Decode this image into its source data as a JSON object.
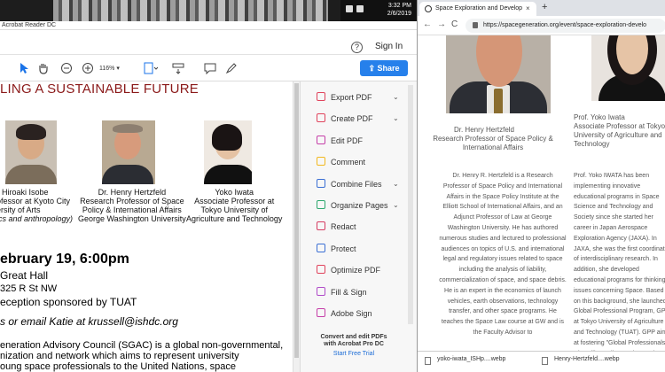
{
  "taskbar": {
    "time": "3:32 PM",
    "date": "2/6/2019"
  },
  "acrobat": {
    "title": "Acrobat Reader DC",
    "help_icon": "?",
    "sign_in": "Sign In",
    "zoom": "116%",
    "share": "Share"
  },
  "pdf": {
    "title": "LING A SUSTAINABLE FUTURE",
    "speakers": [
      {
        "name": "Hiroaki Isobe",
        "line2": "ofessor at Kyoto City",
        "line3": "ersity of Arts",
        "line4": "ics and anthropology)"
      },
      {
        "name": "Dr. Henry Hertzfeld",
        "line2": "Research Professor of Space",
        "line3": "Policy & International Affairs",
        "line4": "George Washington University"
      },
      {
        "name": "Yoko Iwata",
        "line2": "Associate Professor at",
        "line3": "Tokyo University of",
        "line4": "Agriculture and Technology"
      }
    ],
    "date": "ebruary 19, 6:00pm",
    "venue1": "Great Hall",
    "venue2": "325 R St NW",
    "reception": "eception sponsored by TUAT",
    "rsvp": "s or email Katie at krussell@ishdc.org",
    "para1": "eneration Advisory Council (SGAC) is a global non-governmental,",
    "para2": "nization and network which aims to represent university",
    "para3": "oung space professionals to the United Nations, space"
  },
  "tools": {
    "items": [
      {
        "label": "Export PDF",
        "chevron": "⌄",
        "color": "#e0435c"
      },
      {
        "label": "Create PDF",
        "chevron": "⌄",
        "color": "#e0435c"
      },
      {
        "label": "Edit PDF",
        "chevron": "",
        "color": "#c53ea8"
      },
      {
        "label": "Comment",
        "chevron": "",
        "color": "#f2b81f"
      },
      {
        "label": "Combine Files",
        "chevron": "⌄",
        "color": "#3b6fd4"
      },
      {
        "label": "Organize Pages",
        "chevron": "⌄",
        "color": "#2fa86f"
      },
      {
        "label": "Redact",
        "chevron": "",
        "color": "#d63c62"
      },
      {
        "label": "Protect",
        "chevron": "",
        "color": "#3b6fd4"
      },
      {
        "label": "Optimize PDF",
        "chevron": "",
        "color": "#e0435c"
      },
      {
        "label": "Fill & Sign",
        "chevron": "",
        "color": "#b04cc9"
      },
      {
        "label": "Adobe Sign",
        "chevron": "",
        "color": "#c53ea8"
      }
    ],
    "promo_line1": "Convert and edit PDFs",
    "promo_line2": "with Acrobat Pro DC",
    "trial": "Start Free Trial"
  },
  "browser": {
    "tab_title": "Space Exploration and Develop",
    "tab_close": "×",
    "new_tab": "+",
    "back": "←",
    "forward": "→",
    "reload": "C",
    "url": "https://spacegeneration.org/event/space-exploration-develo"
  },
  "web": {
    "hh_name": "Dr. Henry Hertzfeld",
    "hh_title": "Research Professor of Space Policy & International Affairs",
    "yi_name": "Prof. Yoko Iwata",
    "yi_title": "Associate Professor at Tokyo University of Agriculture and Technology",
    "hh_bio": "Dr. Henry R. Hertzfeld is a Research Professor of Space Policy and International Affairs in the Space Policy Institute at the Elliott School of International Affairs, and an Adjunct Professor of Law at George Washington University. He has authored numerous studies and lectured to professional audiences on topics of U.S. and international legal and regulatory issues related to space including the analysis of liability, commercialization of space, and space debris. He is an expert in the economics of launch vehicles, earth observations, technology transfer, and other space programs. He teaches the Space Law course at GW and is the Faculty Advisor to",
    "yi_bio": "Prof. Yoko IWATA has been implementing innovative educational programs in Space Science and Technology and Society since she started her career in Japan Aerospace Exploration Agency (JAXA). In JAXA, she was the first coordinator of interdisciplinary research. In addition, she developed educational programs for thinking issues concerning Space. Based on this background, she launched Global Professional Program, GPP at Tokyo University of Agriculture and Technology (TUAT). GPP aims at fostering \"Global Professionals\" who will contribute to increasing Japan's presence in the global community by creating innovative"
  },
  "downloads": [
    {
      "name": "yoko-iwata_ISHp....webp"
    },
    {
      "name": "Henry-Hertzfeld....webp"
    }
  ]
}
